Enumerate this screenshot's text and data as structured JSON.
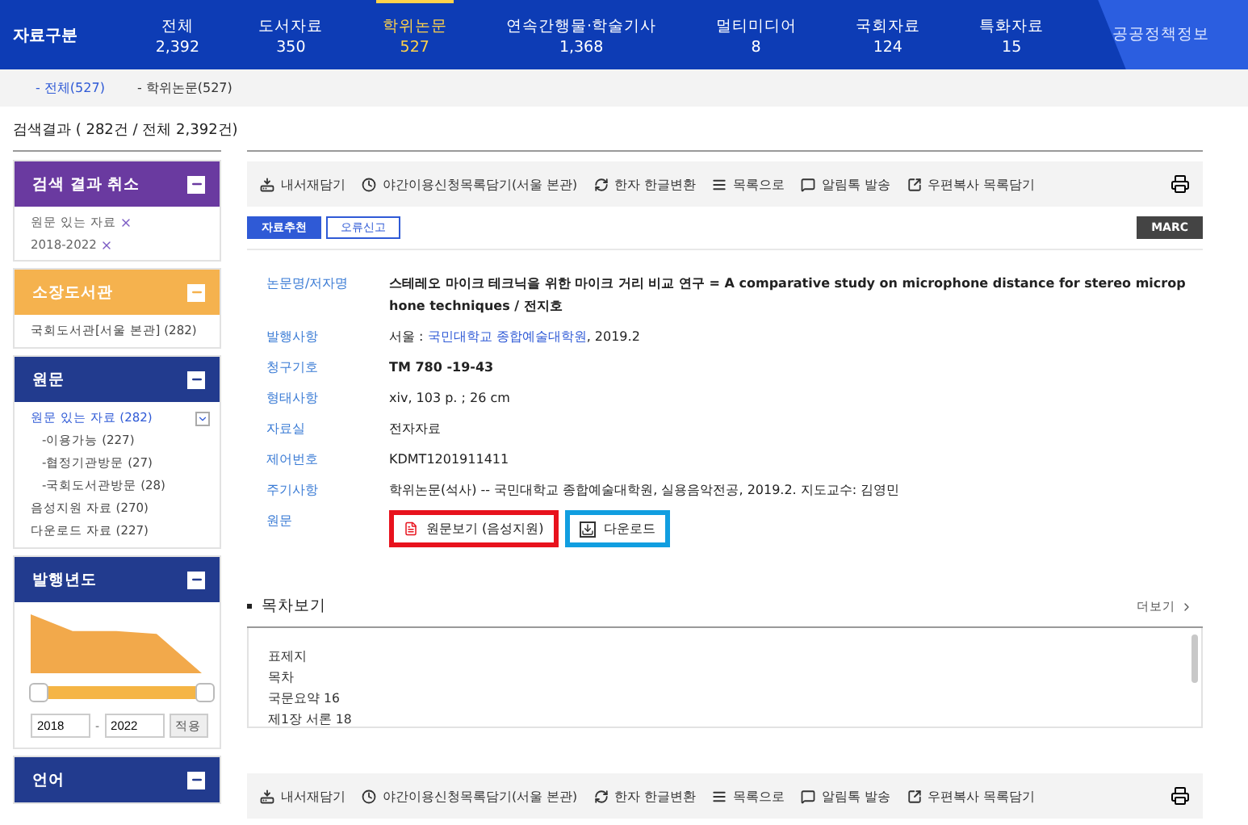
{
  "nav": {
    "label": "자료구분",
    "tabs": [
      {
        "label": "전체",
        "count": "2,392",
        "selected": false
      },
      {
        "label": "도서자료",
        "count": "350",
        "selected": false
      },
      {
        "label": "학위논문",
        "count": "527",
        "selected": true
      },
      {
        "label": "연속간행물·학술기사",
        "count": "1,368",
        "selected": false
      },
      {
        "label": "멀티미디어",
        "count": "8",
        "selected": false
      },
      {
        "label": "국회자료",
        "count": "124",
        "selected": false
      },
      {
        "label": "특화자료",
        "count": "15",
        "selected": false
      }
    ],
    "extra": "공공정책정보"
  },
  "subnav": [
    {
      "label": "- 전체(527)",
      "selected": true
    },
    {
      "label": "- 학위논문(527)",
      "selected": false
    }
  ],
  "result_summary": "검색결과 ( 282건 / 전체 2,392건)",
  "sidebar": [
    {
      "title": "검색 결과 취소",
      "color": "#6a3aa0",
      "kind": "list",
      "items": [
        {
          "kind": "removable",
          "label": "원문 있는 자료"
        },
        {
          "kind": "removable",
          "label": "2018-2022"
        }
      ]
    },
    {
      "title": "소장도서관",
      "color": "#f5b24e",
      "kind": "list",
      "items": [
        {
          "kind": "link",
          "label": "국회도서관[서울 본관] (282)"
        }
      ]
    },
    {
      "title": "원문",
      "color": "#223b8e",
      "kind": "list",
      "items": [
        {
          "kind": "selected",
          "label": "원문 있는 자료 (282)",
          "expanded": true
        },
        {
          "kind": "sub",
          "label": "-이용가능 (227)"
        },
        {
          "kind": "sub",
          "label": "-협정기관방문 (27)"
        },
        {
          "kind": "sub",
          "label": "-국회도서관방문 (28)"
        },
        {
          "kind": "link",
          "label": "음성지원 자료 (270)"
        },
        {
          "kind": "link",
          "label": "다운로드 자료 (227)"
        }
      ]
    },
    {
      "title": "발행년도",
      "color": "#223b8e",
      "kind": "year",
      "from": "2018",
      "separator": "-",
      "to": "2022",
      "apply": "적용",
      "level": 1
    },
    {
      "title": "언어",
      "color": "#223b8e",
      "kind": "list"
    }
  ],
  "toolbars": [
    {
      "items": [
        {
          "kind": "tray",
          "label": "내서재담기"
        },
        {
          "kind": "clock",
          "label": "야간이용신청목록담기(서울 본관)"
        },
        {
          "kind": "refresh",
          "label": "한자 한글변환"
        },
        {
          "kind": "list",
          "label": "목록으로"
        },
        {
          "kind": "chat",
          "label": "알림톡 발송"
        },
        {
          "kind": "export",
          "label": "우편복사 목록담기"
        }
      ]
    },
    {
      "items": [
        {
          "kind": "tray",
          "label": "내서재담기"
        },
        {
          "kind": "clock",
          "label": "야간이용신청목록담기(서울 본관)"
        },
        {
          "kind": "refresh",
          "label": "한자 한글변환"
        },
        {
          "kind": "list",
          "label": "목록으로"
        },
        {
          "kind": "chat",
          "label": "알림톡 발송"
        },
        {
          "kind": "export",
          "label": "우편복사 목록담기"
        }
      ]
    }
  ],
  "actions": [
    {
      "kind": "primary",
      "label": "자료추천"
    },
    {
      "kind": "outline",
      "label": "오류신고"
    },
    {
      "kind": "dark",
      "label": "MARC"
    }
  ],
  "fields": [
    {
      "label": "논문명/저자명",
      "kind": "bold",
      "value": "스테레오 마이크 테크닉을 위한 마이크 거리 비교 연구 = A comparative study on microphone distance for stereo microphone techniques / 전지호"
    },
    {
      "label": "발행사항",
      "kind": "parts",
      "parts": [
        {
          "text": "서울 : ",
          "link": false
        },
        {
          "text": "국민대학교 종합예술대학원",
          "link": true
        },
        {
          "text": ", 2019.2",
          "link": false
        }
      ]
    },
    {
      "label": "청구기호",
      "kind": "bold",
      "value": "TM 780 -19-43"
    },
    {
      "label": "형태사항",
      "kind": "plain",
      "value": "xiv, 103 p. ; 26 cm"
    },
    {
      "label": "자료실",
      "kind": "plain",
      "value": "전자자료"
    },
    {
      "label": "제어번호",
      "kind": "plain",
      "value": "KDMT1201911411"
    },
    {
      "label": "주기사항",
      "kind": "plain",
      "value": "학위논문(석사) -- 국민대학교 종합예술대학원, 실용음악전공, 2019.2. 지도교수: 김영민"
    },
    {
      "label": "원문",
      "kind": "buttons",
      "buttons": [
        {
          "kind": "pdf",
          "label": "원문보기 (음성지원)",
          "color": "#e8121d"
        },
        {
          "kind": "download",
          "label": "다운로드",
          "color": "#119ee0"
        }
      ]
    }
  ],
  "toc": {
    "title": "목차보기",
    "more": "더보기",
    "lines": [
      "표제지",
      "목차",
      "국문요약 16",
      "제1장 서론 18"
    ]
  }
}
